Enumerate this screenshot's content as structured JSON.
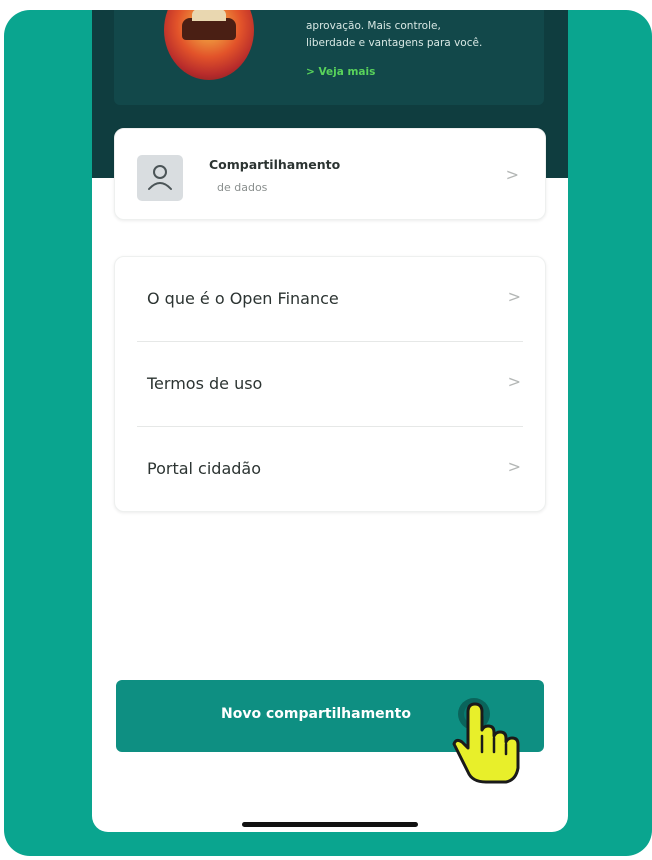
{
  "colors": {
    "frame": "#0aa58f",
    "header": "#0f3d3f",
    "link": "#59d35b",
    "cta": "#0e8f82"
  },
  "promo": {
    "text_line1": "aprovação. Mais controle,",
    "text_line2": "liberdade e vantagens para você.",
    "link": "> Veja mais"
  },
  "share": {
    "icon": "user-icon",
    "title": "Compartilhamento",
    "subtitle": "de dados",
    "chevron": ">"
  },
  "menu": {
    "items": [
      {
        "label": "O que é o Open Finance",
        "chevron": ">"
      },
      {
        "label": "Termos de uso",
        "chevron": ">"
      },
      {
        "label": "Portal cidadão",
        "chevron": ">"
      }
    ]
  },
  "cta": {
    "label": "Novo compartilhamento",
    "icon": "pointer-hand-icon"
  }
}
